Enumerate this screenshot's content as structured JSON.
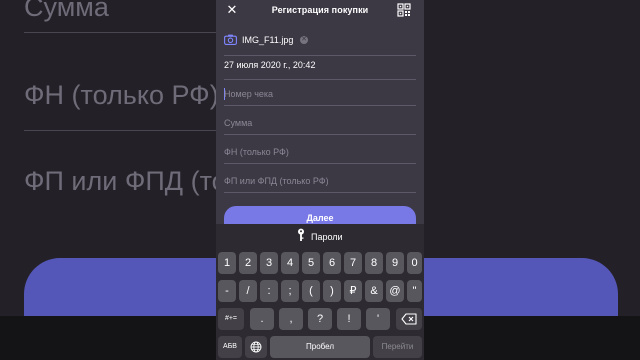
{
  "background": {
    "texts": [
      "Сумма",
      "ФН (только РФ)",
      "ФП или ФПД (то"
    ]
  },
  "header": {
    "title": "Регистрация покупки"
  },
  "form": {
    "photo_name": "IMG_F11.jpg",
    "date_value": "27 июля 2020 г., 20:42",
    "receipt_placeholder": "Номер чека",
    "sum_placeholder": "Сумма",
    "fn_placeholder": "ФН (только РФ)",
    "fp_placeholder": "ФП или ФПД (только РФ)",
    "next_label": "Далее"
  },
  "keyboard": {
    "passwords_label": "Пароли",
    "row1": [
      "1",
      "2",
      "3",
      "4",
      "5",
      "6",
      "7",
      "8",
      "9",
      "0"
    ],
    "row2": [
      "-",
      "/",
      ":",
      ";",
      "(",
      ")",
      "₽",
      "&",
      "@",
      "\""
    ],
    "shift_label": "#+=",
    "row3": [
      ".",
      ",",
      "?",
      "!",
      "'"
    ],
    "lang_label": "АБВ",
    "space_label": "Пробел",
    "go_label": "Перейти"
  },
  "colors": {
    "accent": "#7878e6",
    "panel": "#3c3844",
    "keyboard": "#2d2b31",
    "cursor": "#7f86ff"
  }
}
